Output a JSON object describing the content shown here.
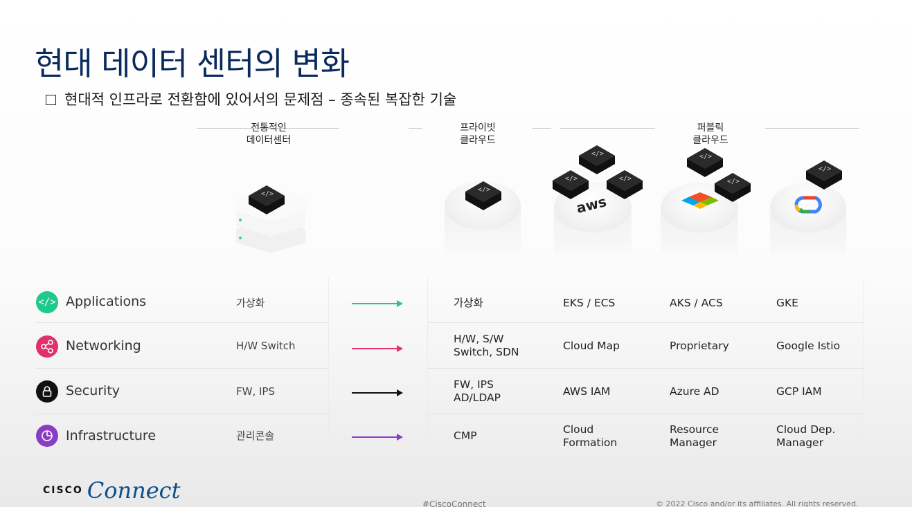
{
  "slide": {
    "title": "현대 데이터 센터의 변화",
    "subtitle": "현대적 인프라로 전환함에 있어서의  문제점 – 종속된 복잡한 기술"
  },
  "columns": {
    "traditional": {
      "line1": "전통적인",
      "line2": "데이터센터"
    },
    "private": {
      "line1": "프라이빗",
      "line2": "클라우드"
    },
    "public": {
      "line1": "퍼블릭",
      "line2": "클라우드"
    }
  },
  "rows": [
    {
      "label": "Applications",
      "icon": "code-icon",
      "icon_color": "#1ec98a",
      "traditional": "가상화",
      "arrow_color": "#1ec98a",
      "private": "가상화",
      "aws": "EKS / ECS",
      "azure": "AKS / ACS",
      "gcp": "GKE"
    },
    {
      "label": "Networking",
      "icon": "share-nodes-icon",
      "icon_color": "#e0316d",
      "traditional": "H/W Switch",
      "arrow_color": "#e0316d",
      "private": "H/W, S/W\nSwitch, SDN",
      "aws": "Cloud Map",
      "azure": "Proprietary",
      "gcp": "Google Istio"
    },
    {
      "label": "Security",
      "icon": "lock-icon",
      "icon_color": "#111111",
      "traditional": "FW, IPS",
      "arrow_color": "#111111",
      "private": "FW, IPS\nAD/LDAP",
      "aws": "AWS IAM",
      "azure": "Azure AD",
      "gcp": "GCP IAM"
    },
    {
      "label": "Infrastructure",
      "icon": "pie-chart-icon",
      "icon_color": "#8a3dc4",
      "traditional": "관리콘솔",
      "arrow_color": "#8a3dc4",
      "private": "CMP",
      "aws": "Cloud\nFormation",
      "azure": "Resource\nManager",
      "gcp": "Cloud Dep.\nManager"
    }
  ],
  "logos": {
    "aws": "aws"
  },
  "footer": {
    "brand_cisco": "CISCO",
    "brand_connect": "Connect",
    "hashtag": "#CiscoConnect",
    "copyright": "© 2022  Cisco and/or its affiliates. All rights reserved."
  }
}
